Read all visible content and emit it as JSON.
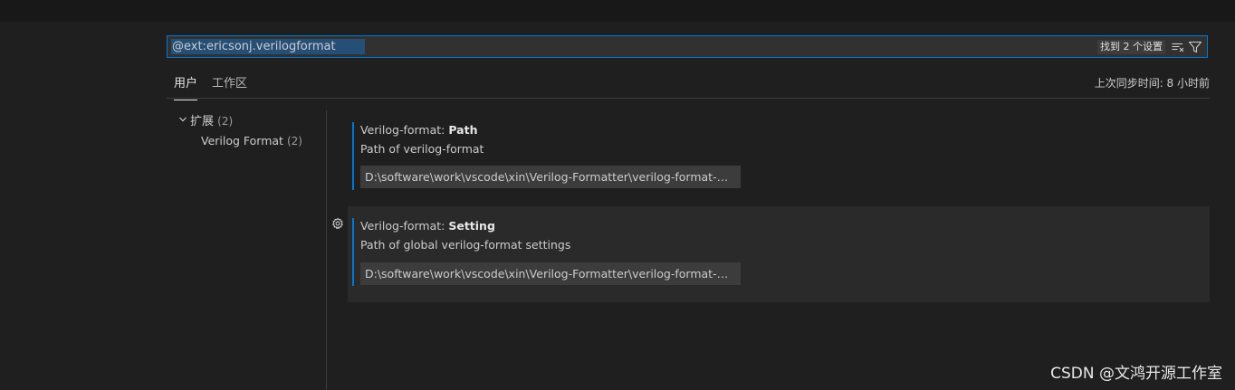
{
  "search": {
    "query": "@ext:ericsonj.verilogformat",
    "result_badge": "找到 2 个设置"
  },
  "tabs": [
    {
      "label": "用户",
      "active": true
    },
    {
      "label": "工作区",
      "active": false
    }
  ],
  "last_sync": "上次同步时间: 8 小时前",
  "toc": {
    "group_label": "扩展",
    "group_count": "(2)",
    "item_label": "Verilog Format",
    "item_count": "(2)"
  },
  "settings": [
    {
      "category": "Verilog-format: ",
      "name": "Path",
      "description": "Path of verilog-format",
      "value": "D:\\software\\work\\vscode\\xin\\Verilog-Formatter\\verilog-format-master\\bin\\verilog-format.exe"
    },
    {
      "category": "Verilog-format: ",
      "name": "Setting",
      "description": "Path of global verilog-format settings",
      "value": "D:\\software\\work\\vscode\\xin\\Verilog-Formatter\\verilog-format-master\\bin\\.verilog-format.properties"
    }
  ],
  "watermark": "CSDN @文鸿开源工作室",
  "colors": {
    "accent": "#0078d4",
    "background": "#1f1f1f",
    "input_background": "#3c3c3c"
  },
  "icons": [
    "clear-filter-icon",
    "filter-icon",
    "chevron-down-icon",
    "gear-icon"
  ]
}
